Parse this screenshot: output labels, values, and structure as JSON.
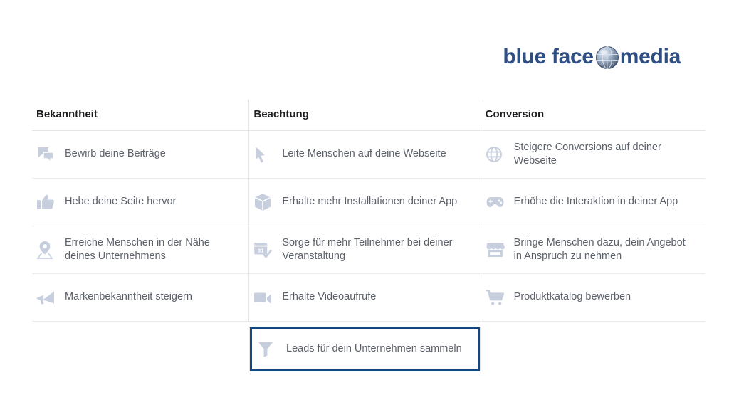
{
  "logo": {
    "text_left": "blue face",
    "text_right": "media",
    "globe_icon": "globe-icon",
    "brand_color": "#2f4f84"
  },
  "board": {
    "columns": [
      {
        "header": "Bekanntheit",
        "items": [
          {
            "icon": "speech-bubbles-icon",
            "label": "Bewirb deine Beiträge"
          },
          {
            "icon": "thumbs-up-icon",
            "label": "Hebe deine Seite hervor"
          },
          {
            "icon": "location-pin-icon",
            "label": "Erreiche Menschen in der Nähe deines Unternehmens"
          },
          {
            "icon": "megaphone-icon",
            "label": "Markenbekanntheit steigern"
          }
        ]
      },
      {
        "header": "Beachtung",
        "items": [
          {
            "icon": "cursor-arrow-icon",
            "label": "Leite Menschen auf deine Webseite"
          },
          {
            "icon": "app-box-icon",
            "label": "Erhalte mehr Installationen deiner App"
          },
          {
            "icon": "calendar-event-icon",
            "label": "Sorge für mehr Teilnehmer bei deiner Veranstaltung"
          },
          {
            "icon": "video-camera-icon",
            "label": "Erhalte Videoaufrufe"
          }
        ]
      },
      {
        "header": "Conversion",
        "items": [
          {
            "icon": "globe-web-icon",
            "label": "Steigere Conversions auf deiner Webseite"
          },
          {
            "icon": "game-controller-icon",
            "label": "Erhöhe die Interaktion in deiner App"
          },
          {
            "icon": "storefront-icon",
            "label": "Bringe Menschen dazu, dein Angebot in Anspruch zu nehmen"
          },
          {
            "icon": "shopping-cart-icon",
            "label": "Produktkatalog bewerben"
          }
        ]
      }
    ],
    "highlighted_item": {
      "icon": "funnel-icon",
      "label": "Leads für dein Unternehmen sammeln",
      "column": "Beachtung",
      "border_color": "#14467f"
    },
    "icon_color": "#c7cfde",
    "text_color": "#5b6069",
    "header_color": "#1c1e21",
    "divider_color": "#e3e5e8"
  }
}
